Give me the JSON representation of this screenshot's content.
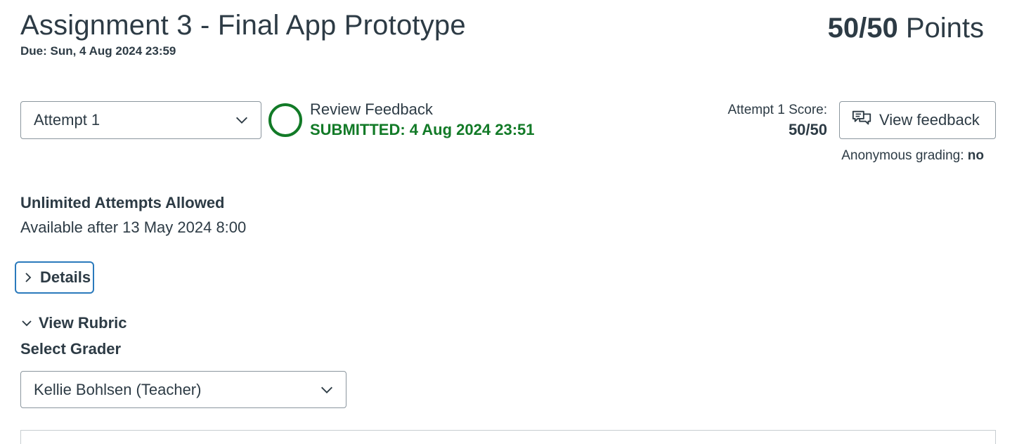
{
  "assignment": {
    "title": "Assignment 3 - Final App Prototype",
    "due": "Due: Sun, 4 Aug 2024 23:59",
    "points_score": "50/50",
    "points_label": "Points"
  },
  "attempt": {
    "selected": "Attempt 1",
    "status_title": "Review Feedback",
    "submitted": "SUBMITTED: 4 Aug 2024 23:51",
    "score_label": "Attempt 1 Score:",
    "score_value": "50/50",
    "view_feedback_label": "View feedback",
    "anonymous_label": "Anonymous grading:",
    "anonymous_value": "no"
  },
  "info": {
    "attempts": "Unlimited Attempts Allowed",
    "available": "Available after 13 May 2024 8:00"
  },
  "details": {
    "label": "Details"
  },
  "rubric": {
    "label": "View Rubric",
    "grader_label": "Select Grader",
    "grader_selected": "Kellie Bohlsen (Teacher)"
  },
  "colors": {
    "text": "#2d3b45",
    "submitted_green": "#127a27",
    "focus_blue": "#2b7abc",
    "border": "#8b969e"
  },
  "icons": {
    "attempt_chevron": "chevron-down-icon",
    "status": "status-circle-icon",
    "feedback": "feedback-speech-bubbles-icon",
    "details_chevron": "chevron-right-icon",
    "rubric_chevron": "chevron-down-icon",
    "grader_chevron": "chevron-down-icon"
  }
}
